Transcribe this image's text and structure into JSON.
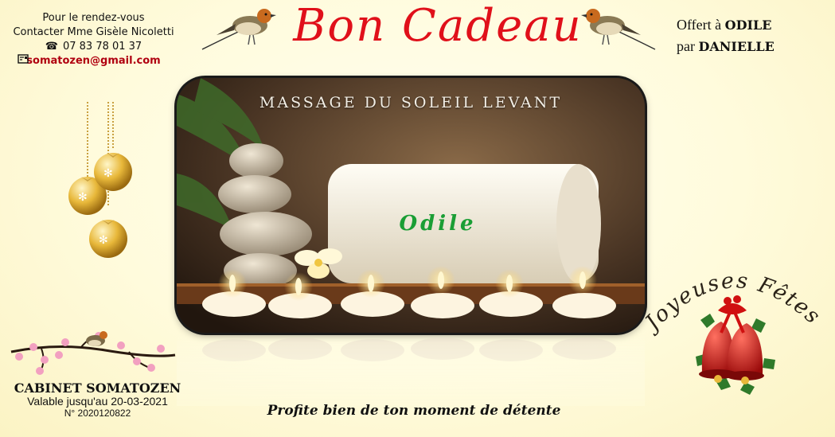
{
  "contact": {
    "line1": "Pour le rendez-vous",
    "line2": "Contacter Mme Gisèle Nicoletti",
    "phone": "07 83 78 01 37",
    "email": "somatozen@gmail.com"
  },
  "title": "Bon Cadeau",
  "offer": {
    "offered_prefix": "Offert à",
    "offered_to": "ODILE",
    "by_prefix": "par",
    "by_name": "DANIELLE"
  },
  "card": {
    "massage_title": "MASSAGE DU SOLEIL LEVANT",
    "recipient": "Odile"
  },
  "greeting": "Joyeuses Fêtes",
  "footer": {
    "cabinet": "CABINET SOMATOZEN",
    "valid_until": "Valable jusqu'au 20-03-2021",
    "serial": "N° 2020120822",
    "tagline": "Profite bien de ton moment de détente"
  },
  "colors": {
    "title": "#e0101a",
    "email": "#b00010",
    "recipient": "#1a9e35"
  },
  "icons": {
    "phone": "phone-icon",
    "mail": "mailbox-icon"
  }
}
